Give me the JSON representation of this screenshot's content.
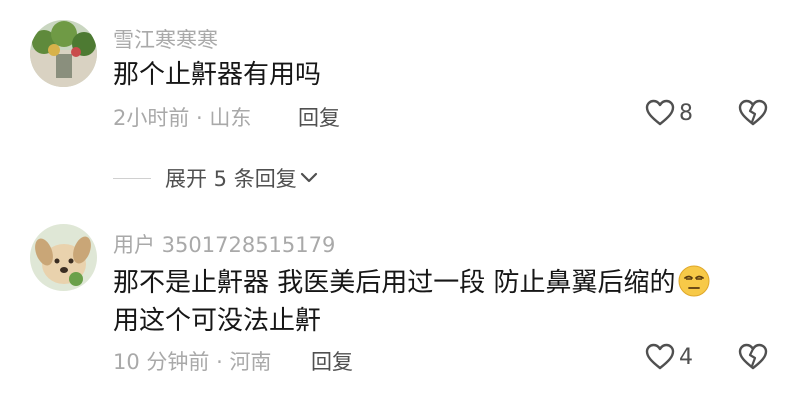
{
  "comments": [
    {
      "username": "雪江寒寒寒",
      "text_lines": [
        "那个止鼾器有用吗"
      ],
      "time": "2小时前",
      "location": "山东",
      "reply_label": "回复",
      "like_count": "8",
      "avatar_icon": "plant-photo-avatar"
    },
    {
      "username": "用户 3501728515179",
      "text_lines": [
        "那不是止鼾器 我医美后用过一段 防止鼻翼后缩的",
        "用这个可没法止鼾"
      ],
      "emoji": "smug-face-emoji",
      "time": "10 分钟前",
      "location": "河南",
      "reply_label": "回复",
      "like_count": "4",
      "avatar_icon": "dog-illustration-avatar"
    }
  ],
  "expand_replies": {
    "label": "展开 5 条回复"
  },
  "colors": {
    "text": "#161616",
    "muted": "#a9a9a9",
    "action": "#505050"
  }
}
